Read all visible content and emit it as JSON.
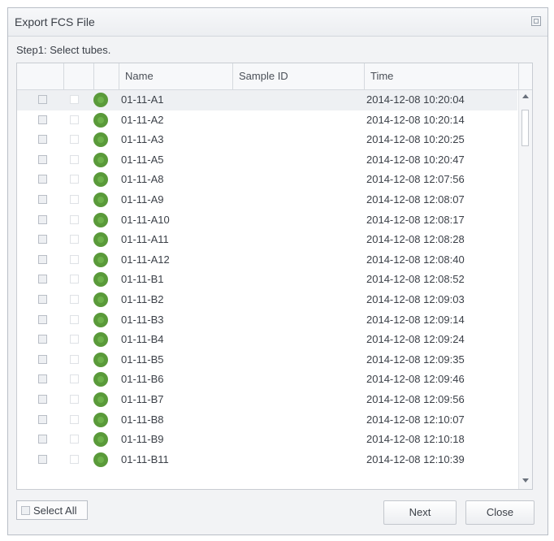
{
  "window": {
    "title": "Export FCS File"
  },
  "step": "Step1:  Select tubes.",
  "table": {
    "headers": {
      "name": "Name",
      "sample_id": "Sample ID",
      "time": "Time"
    },
    "rows": [
      {
        "name": "01-11-A1",
        "sample_id": "",
        "time": "2014-12-08 10:20:04"
      },
      {
        "name": "01-11-A2",
        "sample_id": "",
        "time": "2014-12-08 10:20:14"
      },
      {
        "name": "01-11-A3",
        "sample_id": "",
        "time": "2014-12-08 10:20:25"
      },
      {
        "name": "01-11-A5",
        "sample_id": "",
        "time": "2014-12-08 10:20:47"
      },
      {
        "name": "01-11-A8",
        "sample_id": "",
        "time": "2014-12-08 12:07:56"
      },
      {
        "name": "01-11-A9",
        "sample_id": "",
        "time": "2014-12-08 12:08:07"
      },
      {
        "name": "01-11-A10",
        "sample_id": "",
        "time": "2014-12-08 12:08:17"
      },
      {
        "name": "01-11-A11",
        "sample_id": "",
        "time": "2014-12-08 12:08:28"
      },
      {
        "name": "01-11-A12",
        "sample_id": "",
        "time": "2014-12-08 12:08:40"
      },
      {
        "name": "01-11-B1",
        "sample_id": "",
        "time": "2014-12-08 12:08:52"
      },
      {
        "name": "01-11-B2",
        "sample_id": "",
        "time": "2014-12-08 12:09:03"
      },
      {
        "name": "01-11-B3",
        "sample_id": "",
        "time": "2014-12-08 12:09:14"
      },
      {
        "name": "01-11-B4",
        "sample_id": "",
        "time": "2014-12-08 12:09:24"
      },
      {
        "name": "01-11-B5",
        "sample_id": "",
        "time": "2014-12-08 12:09:35"
      },
      {
        "name": "01-11-B6",
        "sample_id": "",
        "time": "2014-12-08 12:09:46"
      },
      {
        "name": "01-11-B7",
        "sample_id": "",
        "time": "2014-12-08 12:09:56"
      },
      {
        "name": "01-11-B8",
        "sample_id": "",
        "time": "2014-12-08 12:10:07"
      },
      {
        "name": "01-11-B9",
        "sample_id": "",
        "time": "2014-12-08 12:10:18"
      },
      {
        "name": "01-11-B11",
        "sample_id": "",
        "time": "2014-12-08 12:10:39"
      }
    ]
  },
  "footer": {
    "select_all": "Select All",
    "next": "Next",
    "close": "Close"
  },
  "icons": {
    "restore": "restore-icon",
    "status": "status-icon"
  },
  "colors": {
    "status_green": "#5a9a3a",
    "status_green_light": "#6db14a"
  }
}
